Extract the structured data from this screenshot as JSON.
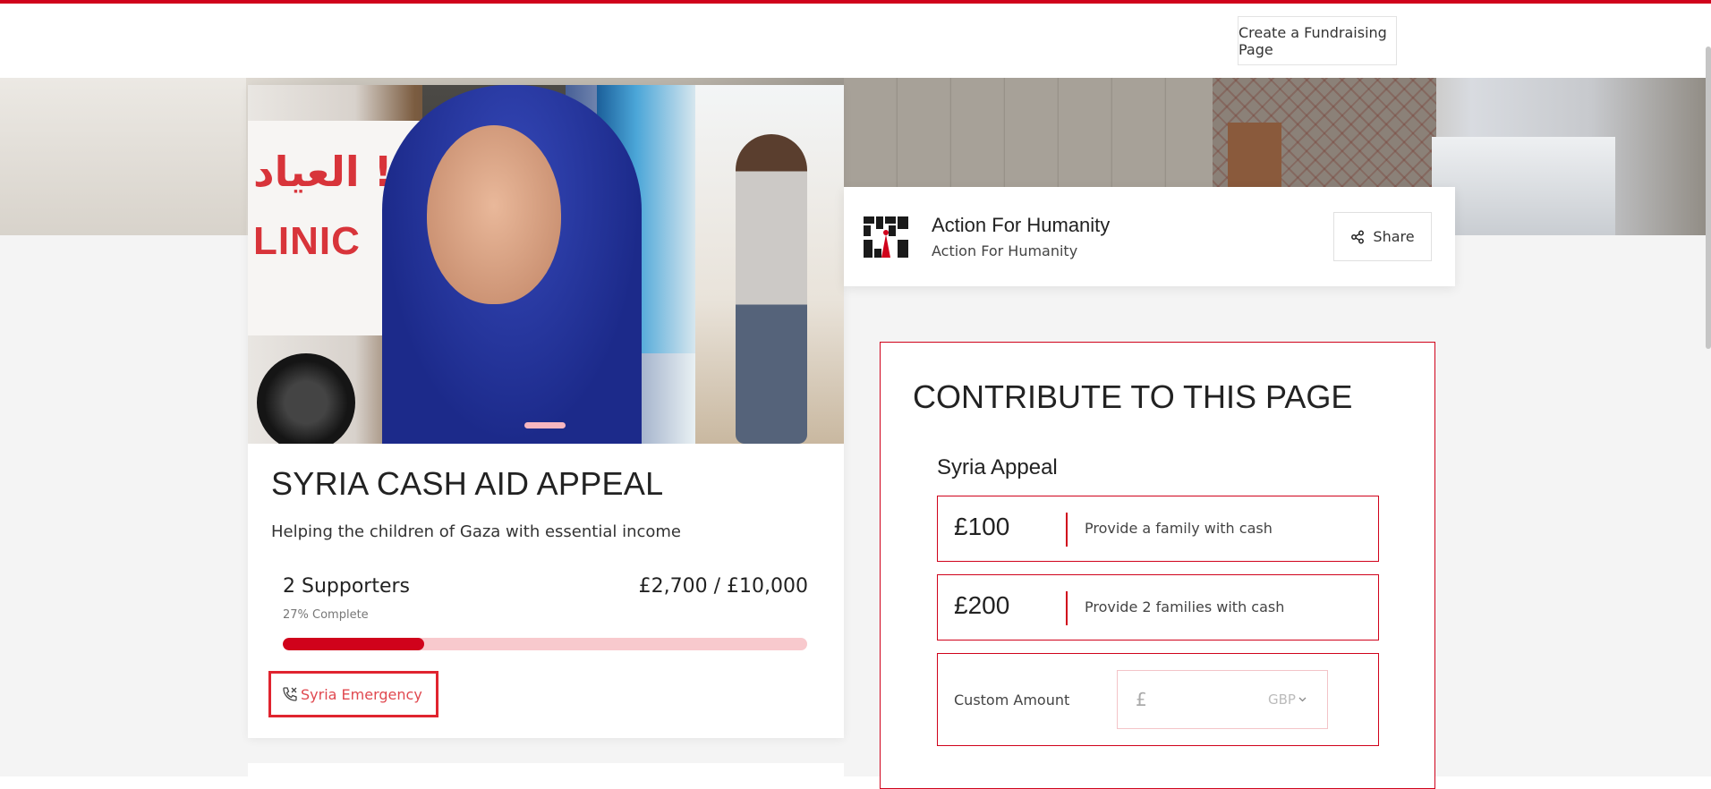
{
  "header": {
    "create_page_label": "Create a Fundraising Page"
  },
  "campaign": {
    "title": "SYRIA CASH AID APPEAL",
    "subtitle": "Helping the children of Gaza with essential income",
    "supporters": "2 Supporters",
    "raised": "£2,700 / £10,000",
    "complete_text": "27% Complete",
    "progress_fraction": 0.27,
    "tag_label": "Syria Emergency",
    "photo_clinic_text": "LINIC",
    "photo_arabic_text": "العياد !!"
  },
  "org": {
    "name": "Action For Humanity",
    "subname": "Action For Humanity",
    "share_label": "Share"
  },
  "contribute": {
    "title": "CONTRIBUTE TO THIS PAGE",
    "appeal_name": "Syria Appeal",
    "options": [
      {
        "amount": "£100",
        "description": "Provide a family with cash"
      },
      {
        "amount": "£200",
        "description": "Provide 2 families with cash"
      }
    ],
    "custom_label": "Custom Amount",
    "currency_symbol": "£",
    "currency": "GBP"
  },
  "colors": {
    "accent": "#d0021b",
    "progress_track": "#f8c9cd"
  }
}
